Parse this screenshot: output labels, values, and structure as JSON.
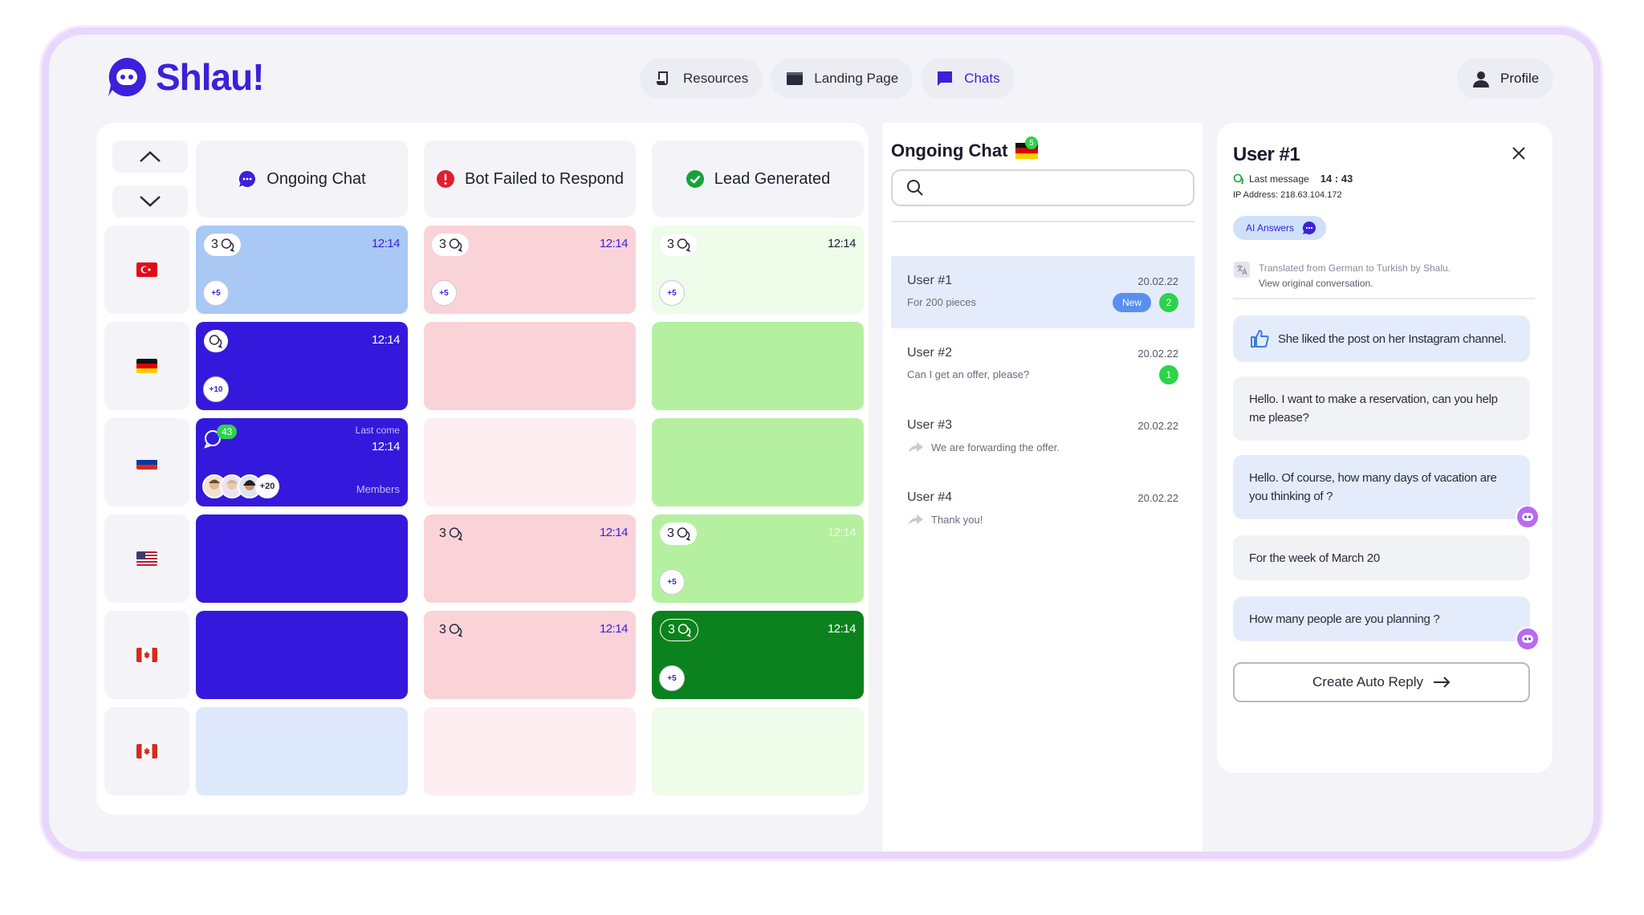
{
  "app": {
    "name": "Shlau!"
  },
  "nav": {
    "items": [
      {
        "label": "Resources",
        "icon": "scroll-icon"
      },
      {
        "label": "Landing Page",
        "icon": "browser-window-icon"
      },
      {
        "label": "Chats",
        "icon": "chat-flag-icon",
        "active": true
      }
    ],
    "profile": "Profile"
  },
  "board": {
    "columns": [
      {
        "label": "Ongoing Chat",
        "icon": "chat-bubble-icon",
        "color": "#3b21d9"
      },
      {
        "label": "Bot Failed to Respond",
        "icon": "alert-icon",
        "color": "#e21d2f"
      },
      {
        "label": "Lead Generated",
        "icon": "check-circle-icon",
        "color": "#17a13b"
      }
    ],
    "rows": [
      {
        "flag": "turkey-flag",
        "cells": [
          {
            "variant": "blue-light",
            "count": "3",
            "time": "12:14",
            "plus": "+5"
          },
          {
            "variant": "pink",
            "count": "3",
            "time": "12:14",
            "plus": "+5"
          },
          {
            "variant": "green-pale",
            "count": "3",
            "time": "12:14",
            "plus": "+5"
          }
        ]
      },
      {
        "flag": "germany-flag",
        "cells": [
          {
            "variant": "blue",
            "count": "",
            "time": "12:14",
            "plus": "+10"
          },
          {
            "variant": "pink"
          },
          {
            "variant": "green"
          }
        ]
      },
      {
        "flag": "russia-flag",
        "cells": [
          {
            "variant": "blue",
            "badge": "43",
            "last_come": "Last come",
            "time": "12:14",
            "members_more": "+20",
            "members": "Members"
          },
          {
            "variant": "pink-pale"
          },
          {
            "variant": "green"
          }
        ]
      },
      {
        "flag": "usa-flag",
        "cells": [
          {
            "variant": "blue"
          },
          {
            "variant": "pink",
            "count": "3",
            "time": "12:14"
          },
          {
            "variant": "green",
            "count": "3",
            "time": "12:14",
            "plus": "+5"
          }
        ]
      },
      {
        "flag": "canada-flag",
        "cells": [
          {
            "variant": "blue"
          },
          {
            "variant": "pink",
            "count": "3",
            "time": "12:14"
          },
          {
            "variant": "green-dark",
            "count": "3",
            "time": "12:14",
            "plus": "+5"
          }
        ]
      },
      {
        "flag": "canada-flag",
        "cells": [
          {
            "variant": "blue-pale"
          },
          {
            "variant": "pink-pale"
          },
          {
            "variant": "green-pale"
          }
        ]
      }
    ]
  },
  "chatlist": {
    "title": "Ongoing Chat",
    "flag_badge": "5",
    "search_placeholder": "",
    "conversations": [
      {
        "name": "User #1",
        "date": "20.02.22",
        "preview": "For 200 pieces",
        "new": "New",
        "count": "2",
        "selected": true
      },
      {
        "name": "User #2",
        "date": "20.02.22",
        "preview": "Can I get an offer, please?",
        "count": "1"
      },
      {
        "name": "User #3",
        "date": "20.02.22",
        "preview": "We are forwarding the offer.",
        "forwarded": true
      },
      {
        "name": "User #4",
        "date": "20.02.22",
        "preview": "Thank you!",
        "forwarded": true
      }
    ]
  },
  "detail": {
    "user": "User #1",
    "last_message_label": "Last message",
    "last_message_time": "14 : 43",
    "ip": "IP Address: 218.63.104.172",
    "ai_answers": "AI Answers",
    "translated_line1": "Translated from German to Turkish by Shalu.",
    "translated_line2": "View original conversation.",
    "messages": [
      {
        "text": "She liked the post on her Instagram channel.",
        "style": "blue",
        "like": true
      },
      {
        "text": "Hello. I want to make a reservation, can you help me please?",
        "style": "grey"
      },
      {
        "text": "Hello. Of course, how many days of vacation are you thinking of ?",
        "style": "blue",
        "bot": true
      },
      {
        "text": "For the week of March 20",
        "style": "grey"
      },
      {
        "text": "How many people are you planning ?",
        "style": "blue",
        "bot": true
      }
    ],
    "auto_reply": "Create Auto Reply"
  }
}
